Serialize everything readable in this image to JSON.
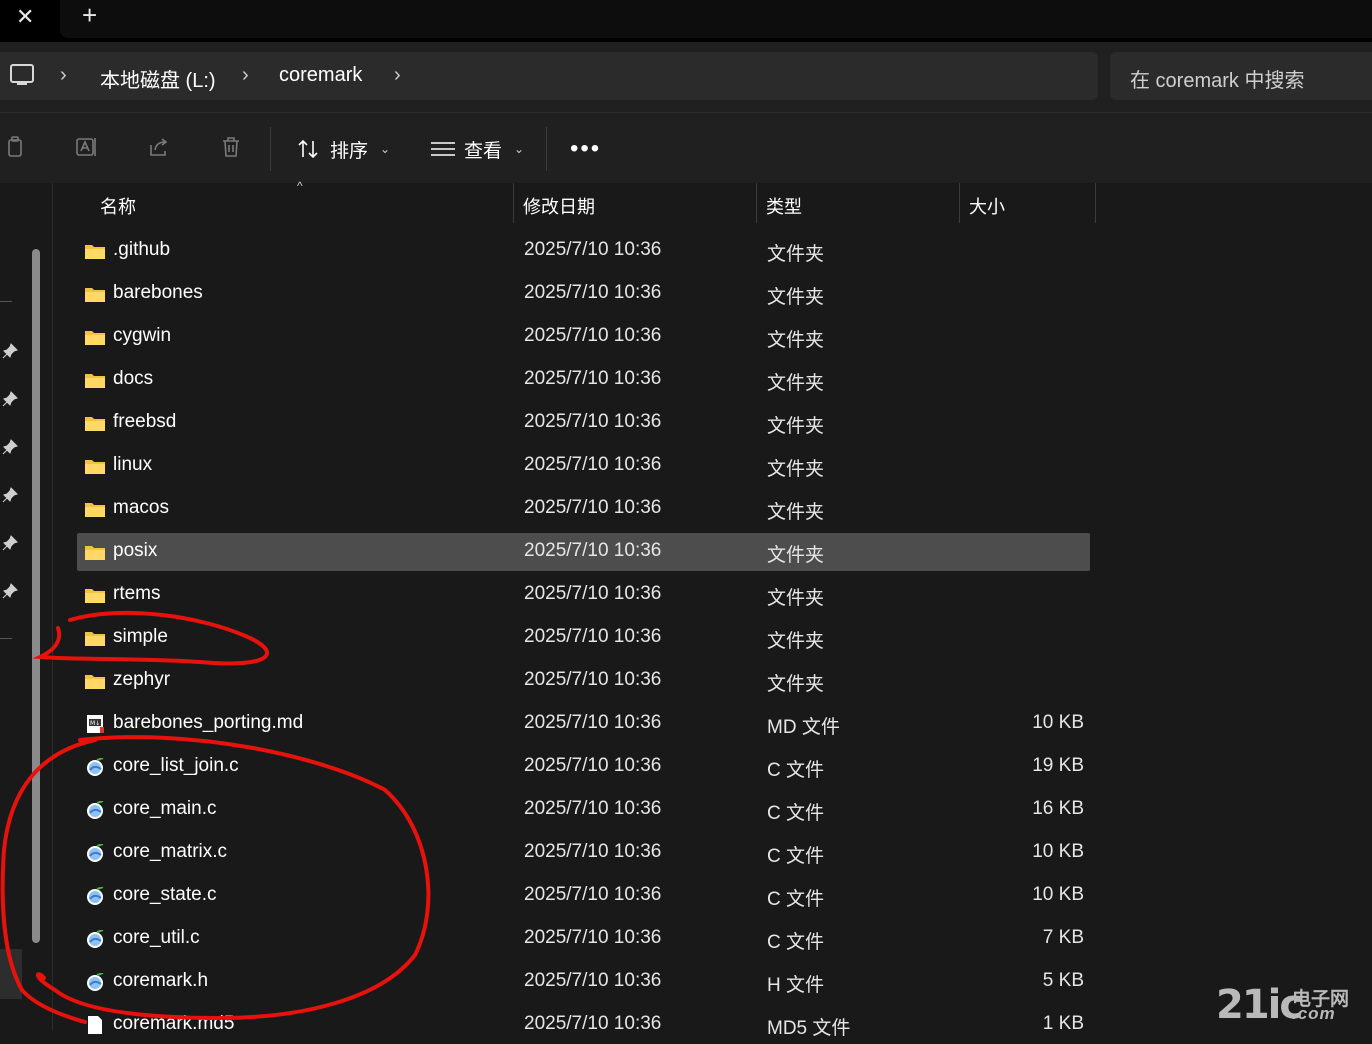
{
  "tabbar": {
    "close_glyph": "✕",
    "add_glyph": "+"
  },
  "address": {
    "root_icon": "computer-icon",
    "separator": "›",
    "crumbs": [
      "本地磁盘 (L:)",
      "coremark"
    ],
    "search_placeholder": "在 coremark 中搜索"
  },
  "toolbar": {
    "icons": [
      "copy-icon",
      "rename-icon",
      "share-icon",
      "delete-icon"
    ],
    "sort_label": "排序",
    "view_label": "查看",
    "more_label": "•••",
    "chevron": "⌄"
  },
  "columns": {
    "name": "名称",
    "date": "修改日期",
    "type": "类型",
    "size": "大小",
    "sort_caret": "^"
  },
  "files": [
    {
      "name": ".github",
      "date": "2025/7/10 10:36",
      "type": "文件夹",
      "size": "",
      "icon": "folder-icon"
    },
    {
      "name": "barebones",
      "date": "2025/7/10 10:36",
      "type": "文件夹",
      "size": "",
      "icon": "folder-icon"
    },
    {
      "name": "cygwin",
      "date": "2025/7/10 10:36",
      "type": "文件夹",
      "size": "",
      "icon": "folder-icon"
    },
    {
      "name": "docs",
      "date": "2025/7/10 10:36",
      "type": "文件夹",
      "size": "",
      "icon": "folder-icon"
    },
    {
      "name": "freebsd",
      "date": "2025/7/10 10:36",
      "type": "文件夹",
      "size": "",
      "icon": "folder-icon"
    },
    {
      "name": "linux",
      "date": "2025/7/10 10:36",
      "type": "文件夹",
      "size": "",
      "icon": "folder-icon"
    },
    {
      "name": "macos",
      "date": "2025/7/10 10:36",
      "type": "文件夹",
      "size": "",
      "icon": "folder-icon"
    },
    {
      "name": "posix",
      "date": "2025/7/10 10:36",
      "type": "文件夹",
      "size": "",
      "icon": "folder-icon",
      "selected": true
    },
    {
      "name": "rtems",
      "date": "2025/7/10 10:36",
      "type": "文件夹",
      "size": "",
      "icon": "folder-icon"
    },
    {
      "name": "simple",
      "date": "2025/7/10 10:36",
      "type": "文件夹",
      "size": "",
      "icon": "folder-icon"
    },
    {
      "name": "zephyr",
      "date": "2025/7/10 10:36",
      "type": "文件夹",
      "size": "",
      "icon": "folder-icon"
    },
    {
      "name": "barebones_porting.md",
      "date": "2025/7/10 10:36",
      "type": "MD 文件",
      "size": "10 KB",
      "icon": "markdown-file-icon"
    },
    {
      "name": "core_list_join.c",
      "date": "2025/7/10 10:36",
      "type": "C 文件",
      "size": "19 KB",
      "icon": "c-source-file-icon"
    },
    {
      "name": "core_main.c",
      "date": "2025/7/10 10:36",
      "type": "C 文件",
      "size": "16 KB",
      "icon": "c-source-file-icon"
    },
    {
      "name": "core_matrix.c",
      "date": "2025/7/10 10:36",
      "type": "C 文件",
      "size": "10 KB",
      "icon": "c-source-file-icon"
    },
    {
      "name": "core_state.c",
      "date": "2025/7/10 10:36",
      "type": "C 文件",
      "size": "10 KB",
      "icon": "c-source-file-icon"
    },
    {
      "name": "core_util.c",
      "date": "2025/7/10 10:36",
      "type": "C 文件",
      "size": "7 KB",
      "icon": "c-source-file-icon"
    },
    {
      "name": "coremark.h",
      "date": "2025/7/10 10:36",
      "type": "H 文件",
      "size": "5 KB",
      "icon": "c-header-file-icon"
    },
    {
      "name": "coremark.md5",
      "date": "2025/7/10 10:36",
      "type": "MD5 文件",
      "size": "1 KB",
      "icon": "generic-file-icon"
    }
  ],
  "annotation": {
    "color": "#e8120c"
  },
  "watermark": {
    "main": "21ic",
    "cn": "电子网",
    "com": ".com"
  },
  "colors": {
    "selected_row": "#4d4d4d",
    "folder": "#f4c242"
  }
}
